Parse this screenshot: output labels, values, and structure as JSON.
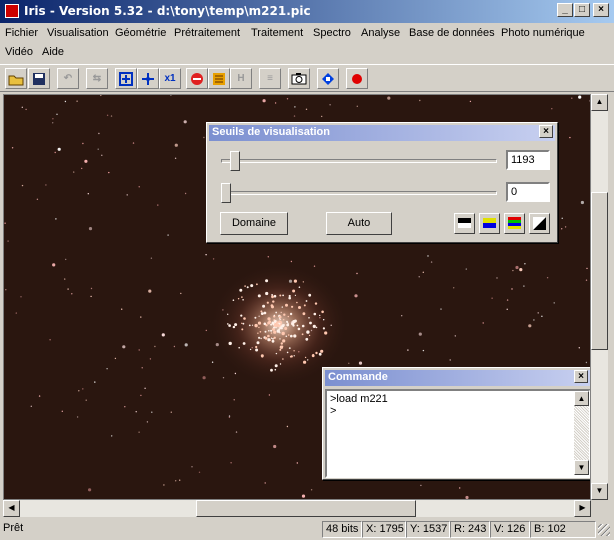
{
  "window": {
    "title": "Iris - Version 5.32 - d:\\tony\\temp\\m221.pic"
  },
  "menu": [
    {
      "label": "Fichier"
    },
    {
      "label": "Visualisation"
    },
    {
      "label": "Géométrie"
    },
    {
      "label": "Prétraitement"
    },
    {
      "label": "Traitement"
    },
    {
      "label": "Spectro"
    },
    {
      "label": "Analyse"
    },
    {
      "label": "Base de données"
    },
    {
      "label": "Photo numérique"
    },
    {
      "label": "Vidéo"
    },
    {
      "label": "Aide"
    }
  ],
  "toolbar": {
    "x1_label": "x1"
  },
  "thresholds": {
    "title": "Seuils de visualisation",
    "high_value": "1193",
    "low_value": "0",
    "domain_label": "Domaine",
    "auto_label": "Auto"
  },
  "command": {
    "title": "Commande",
    "lines": [
      ">load m221",
      ">"
    ]
  },
  "status": {
    "text": "Prêt",
    "bits": "48 bits",
    "x": "X: 1795",
    "y": "Y: 1537",
    "r": "R: 243",
    "v": "V: 126",
    "b": "B: 102"
  },
  "colors": {
    "sky": "#2a160f",
    "title_active": "#0a246a",
    "title_inactive": "#7b8fd0"
  }
}
